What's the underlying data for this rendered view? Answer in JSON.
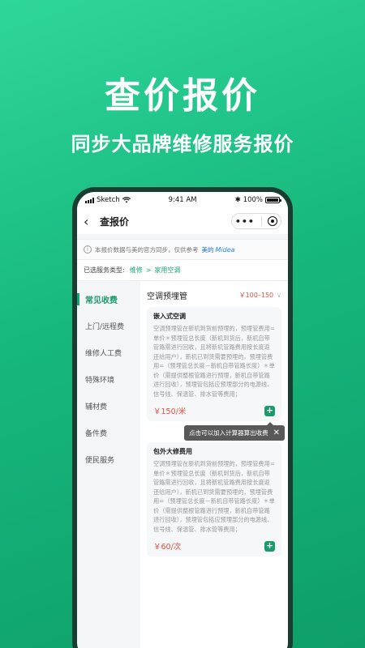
{
  "hero": {
    "title": "查价报价",
    "subtitle": "同步大品牌维修服务报价"
  },
  "statusbar": {
    "carrier": "Sketch",
    "time": "9:41 AM",
    "battery": "100%"
  },
  "navbar": {
    "back_icon": "‹",
    "title": "查报价",
    "more_icon": "•••"
  },
  "notice": {
    "text": "本报价数据与美的官方同步，仅供参考",
    "brand_cn": "美的",
    "brand_logo": "Midea"
  },
  "breadcrumb": {
    "label": "已选服务类型:",
    "level1": "维修",
    "separator": ">",
    "level2": "家用空调"
  },
  "sidebar": {
    "items": [
      {
        "label": "常见收费",
        "active": true
      },
      {
        "label": "上门/远程费"
      },
      {
        "label": "维修人工费"
      },
      {
        "label": "特殊环境"
      },
      {
        "label": "辅材费"
      },
      {
        "label": "备件费"
      },
      {
        "label": "便民服务"
      }
    ]
  },
  "section": {
    "title": "空调预埋管",
    "range": "￥100–150",
    "chevron": "∨"
  },
  "cards": [
    {
      "title": "嵌入式空调",
      "desc": "空调预埋管在新机到货前预埋的，预埋管费用=单价＊预埋管总长度（新机到货后，新机自带管路需进行回收，且将新机管路费用按长度返还给用户），新机已到货需要预埋的，预埋管费用=（预埋管总长度－新机自带管路长度）＊单价（需提供整根管路进行预埋，新机自带管路进行回收），预埋管包括应预埋部分的电源线、信号线、保温管、排水管等费用；",
      "price": "￥150/米",
      "add_icon": "+"
    },
    {
      "title": "包外大修费用",
      "desc": "空调预埋管在新机到货前预埋的，预埋管费用=单价＊预埋管总长度（新机到货后，新机自带管路需进行回收，且将新机管路费用按长度返还给用户），新机已到货需要预埋的，预埋管费用=（预埋管总长度－新机自带管路长度）＊单价（需提供整根管路进行预埋，新机自带管路进行回收），预埋管包括应预埋部分的电源线、信号线、保温管、排水管等费用；",
      "price": "￥60/次",
      "add_icon": "+"
    }
  ],
  "tooltip": {
    "text": "点击可以加入计算器算出收费",
    "close_icon": "✕"
  },
  "colors": {
    "accent": "#17a673",
    "price": "#e84c3d",
    "background_start": "#2fd69a",
    "background_end": "#0e9e6a"
  }
}
